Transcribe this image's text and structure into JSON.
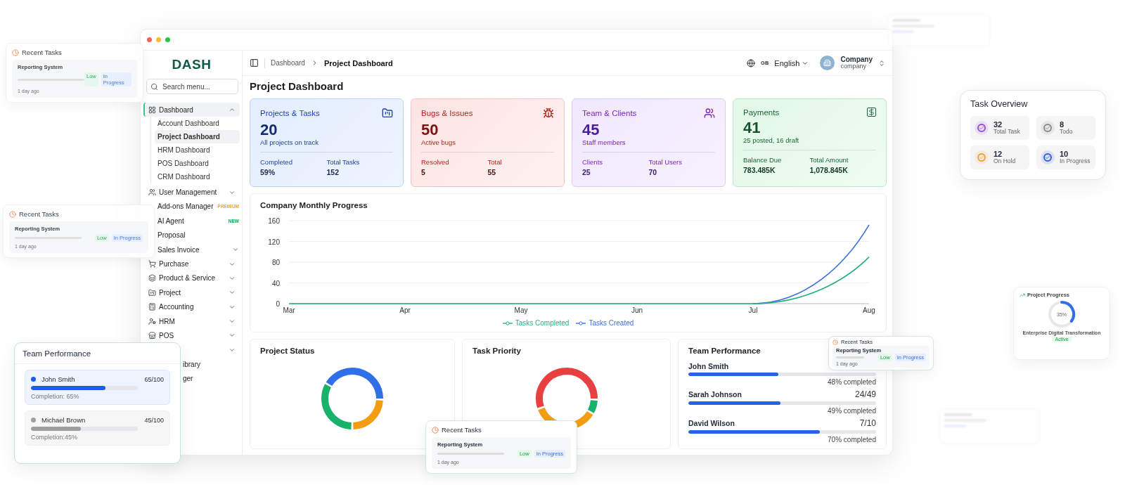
{
  "window": {
    "logo": "DASH"
  },
  "sidebar": {
    "search": {
      "placeholder": "Search menu..."
    },
    "items": [
      {
        "kind": "group",
        "label": "Dashboard",
        "selected": true,
        "expanded": true,
        "children": [
          {
            "label": "Account Dashboard",
            "selected": false
          },
          {
            "label": "Project Dashboard",
            "selected": true
          },
          {
            "label": "HRM Dashboard",
            "selected": false
          },
          {
            "label": "POS Dashboard",
            "selected": false
          },
          {
            "label": "CRM Dashboard",
            "selected": false
          }
        ]
      },
      {
        "kind": "group",
        "label": "User Management",
        "selected": false,
        "expanded": false
      },
      {
        "kind": "group",
        "label": "Add-ons Manager",
        "selected": false,
        "badge": {
          "text": "PREMIUM",
          "color": "#f5a524"
        }
      },
      {
        "kind": "group",
        "label": "AI Agent",
        "selected": false,
        "badge": {
          "text": "NEW",
          "color": "#16a34a"
        }
      },
      {
        "kind": "group",
        "label": "Proposal",
        "selected": false
      },
      {
        "kind": "group",
        "label": "Sales Invoice",
        "selected": false,
        "expanded": false
      },
      {
        "kind": "group",
        "label": "Purchase",
        "selected": false,
        "expanded": false
      },
      {
        "kind": "group",
        "label": "Product & Service",
        "selected": false,
        "expanded": false
      },
      {
        "kind": "group",
        "label": "Project",
        "selected": false,
        "expanded": false
      },
      {
        "kind": "group",
        "label": "Accounting",
        "selected": false,
        "expanded": false
      },
      {
        "kind": "group",
        "label": "HRM",
        "selected": false,
        "expanded": false
      },
      {
        "kind": "group",
        "label": "POS",
        "selected": false,
        "expanded": false
      },
      {
        "kind": "covered",
        "expanded": false
      },
      {
        "kind": "partial",
        "label": "ibrary"
      },
      {
        "kind": "partial",
        "label": "ger"
      }
    ]
  },
  "header": {
    "breadcrumb": [
      "Dashboard",
      "Project Dashboard"
    ],
    "region": "GB",
    "language": "English",
    "account": {
      "name": "Company",
      "role": "company"
    }
  },
  "page_title": "Project Dashboard",
  "stat_cards": [
    {
      "kind": "projects",
      "title": "Projects & Tasks",
      "value": "20",
      "caption": "All projects on track",
      "metrics": [
        {
          "label": "Completed",
          "value": "59%"
        },
        {
          "label": "Total Tasks",
          "value": "152"
        }
      ]
    },
    {
      "kind": "bugs",
      "title": "Bugs & Issues",
      "value": "50",
      "caption": "Active bugs",
      "metrics": [
        {
          "label": "Resolved",
          "value": "5"
        },
        {
          "label": "Total",
          "value": "55"
        }
      ]
    },
    {
      "kind": "team",
      "title": "Team & Clients",
      "value": "45",
      "caption": "Staff members",
      "metrics": [
        {
          "label": "Clients",
          "value": "25"
        },
        {
          "label": "Total Users",
          "value": "70"
        }
      ]
    },
    {
      "kind": "payments",
      "title": "Payments",
      "value": "41",
      "caption": "25 posted, 16 draft",
      "metrics": [
        {
          "label": "Balance Due",
          "value": "783.485K"
        },
        {
          "label": "Total Amount",
          "value": "1,078.845K"
        }
      ]
    }
  ],
  "progress_chart": {
    "title": "Company Monthly Progress",
    "chart_data": {
      "type": "line",
      "grid": true,
      "categories": [
        "Mar",
        "Apr",
        "May",
        "Jun",
        "Jul",
        "Aug"
      ],
      "yticks": [
        0,
        40,
        80,
        120,
        160
      ],
      "ylim": [
        0,
        160
      ],
      "series": [
        {
          "name": "Tasks Completed",
          "color": "#22b07d",
          "values": [
            0,
            0,
            0,
            0,
            0,
            90
          ]
        },
        {
          "name": "Tasks Created",
          "color": "#3b6fe0",
          "values": [
            null,
            null,
            null,
            null,
            0,
            152
          ]
        }
      ]
    }
  },
  "project_status": {
    "title": "Project Status"
  },
  "task_priority": {
    "title": "Task Priority"
  },
  "team_performance": {
    "title": "Team Performance",
    "members": [
      {
        "name": "John Smith",
        "level": 0.48,
        "completion": "48% completed"
      },
      {
        "name": "Sarah Johnson",
        "score": "24/49",
        "level": 0.49,
        "completion": "49% completed"
      },
      {
        "name": "David Wilson",
        "score": "7/10",
        "level": 0.7,
        "completion": "70% completed"
      }
    ]
  },
  "floating": {
    "recent_tasks": [
      {
        "title": "Recent Tasks",
        "task": "Reporting System",
        "priority": "Low",
        "status": "In Progress",
        "time": "1 day ago",
        "blurred": true
      },
      {
        "title": "Recent Tasks",
        "task": "Reporting System",
        "priority": "Low",
        "status": "In Progress",
        "time": "1 day ago",
        "blurred": true
      },
      {
        "title": "Recent Tasks",
        "task": "Reporting System",
        "priority": "Low",
        "status": "In Progress",
        "time": "1 day ago",
        "blurred": false
      },
      {
        "title": "Recent Tasks",
        "task": "Reporting System",
        "priority": "Low",
        "status": "In Progress",
        "time": "1 day ago",
        "blurred": false
      }
    ],
    "team_performance": {
      "title": "Team Performance",
      "members": [
        {
          "name": "John Smith",
          "score": "65/100",
          "level": 0.7,
          "completion": "Completion: 65%",
          "color": "#1d5ce8",
          "selected": true
        },
        {
          "name": "Michael Brown",
          "score": "45/100",
          "level": 0.47,
          "completion": "Completion:45%",
          "color": "#9e9e9e",
          "selected": false
        }
      ]
    },
    "task_overview": {
      "title": "Task Overview",
      "stats": [
        {
          "value": "32",
          "label": "Total Task",
          "color": "#9b4fd6"
        },
        {
          "value": "8",
          "label": "Todo",
          "color": "#8a8a8a"
        },
        {
          "value": "12",
          "label": "On Hold",
          "color": "#e8a23a"
        },
        {
          "value": "10",
          "label": "In Progress",
          "color": "#2f62d9"
        }
      ]
    },
    "project_progress": {
      "title": "Project Progress",
      "percent": "35%",
      "level": 0.35,
      "project": "Enterprise Digital Transformation",
      "status": "Active"
    }
  }
}
